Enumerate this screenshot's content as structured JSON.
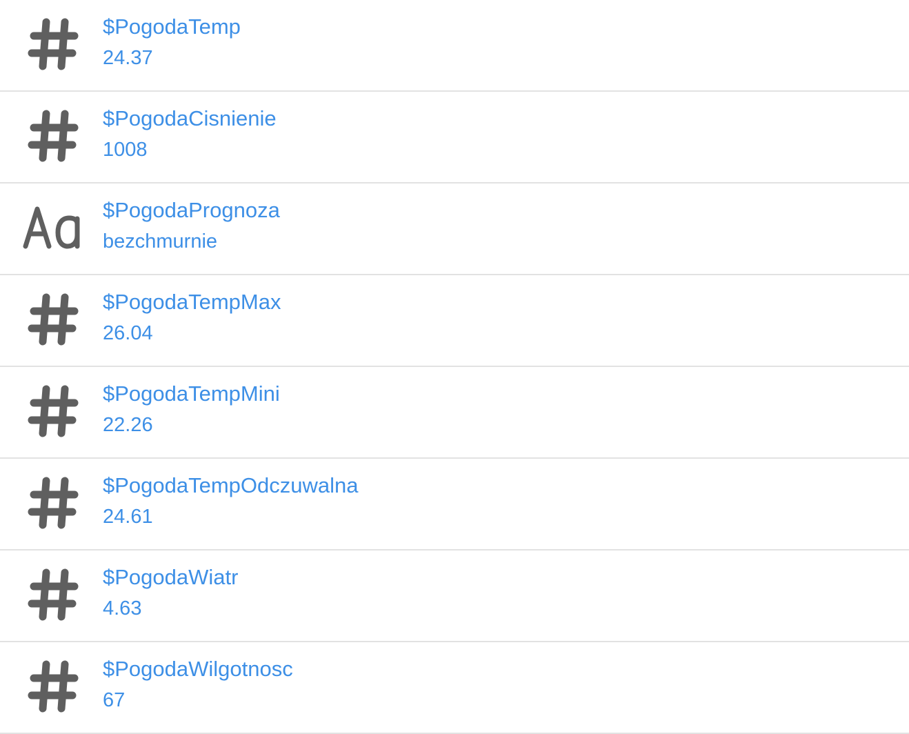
{
  "variables": [
    {
      "name": "$PogodaTemp",
      "value": "24.37",
      "type": "number",
      "icon": "hash-icon"
    },
    {
      "name": "$PogodaCisnienie",
      "value": "1008",
      "type": "number",
      "icon": "hash-icon"
    },
    {
      "name": "$PogodaPrognoza",
      "value": "bezchmurnie",
      "type": "string",
      "icon": "text-aa-icon"
    },
    {
      "name": "$PogodaTempMax",
      "value": "26.04",
      "type": "number",
      "icon": "hash-icon"
    },
    {
      "name": "$PogodaTempMini",
      "value": "22.26",
      "type": "number",
      "icon": "hash-icon"
    },
    {
      "name": "$PogodaTempOdczuwalna",
      "value": "24.61",
      "type": "number",
      "icon": "hash-icon"
    },
    {
      "name": "$PogodaWiatr",
      "value": "4.63",
      "type": "number",
      "icon": "hash-icon"
    },
    {
      "name": "$PogodaWilgotnosc",
      "value": "67",
      "type": "number",
      "icon": "hash-icon"
    }
  ],
  "colors": {
    "accent": "#3d8fe6",
    "icon": "#5f5f5f",
    "divider": "#e2e2e2",
    "background": "#ffffff"
  }
}
